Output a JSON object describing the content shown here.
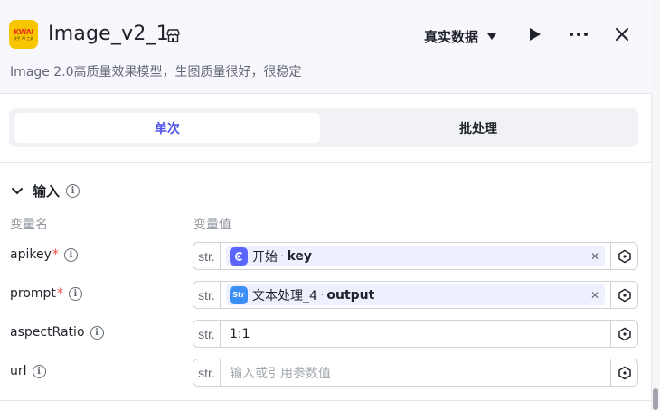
{
  "header": {
    "logo_text": "KWAI",
    "logo_subtext": "快手 AI 工具",
    "title": "Image_v2_1",
    "mode_label": "真实数据",
    "description": "Image 2.0高质量效果模型，生图质量很好，很稳定"
  },
  "tabs": [
    {
      "label": "单次",
      "active": true
    },
    {
      "label": "批处理",
      "active": false
    }
  ],
  "section": {
    "title": "输入",
    "col_name": "变量名",
    "col_value": "变量值"
  },
  "params": [
    {
      "name": "apikey",
      "required": "*",
      "type": "str.",
      "ref_node": "开始",
      "ref_var": "key"
    },
    {
      "name": "prompt",
      "required": "*",
      "type": "str.",
      "ref_node": "文本处理_4",
      "ref_var": "output"
    },
    {
      "name": "aspectRatio",
      "type": "str.",
      "value": "1:1"
    },
    {
      "name": "url",
      "type": "str.",
      "placeholder": "输入或引用参数值"
    }
  ],
  "colors": {
    "accent": "#4d53e8",
    "required": "#f54a45",
    "logo_bg": "#f7c600"
  }
}
